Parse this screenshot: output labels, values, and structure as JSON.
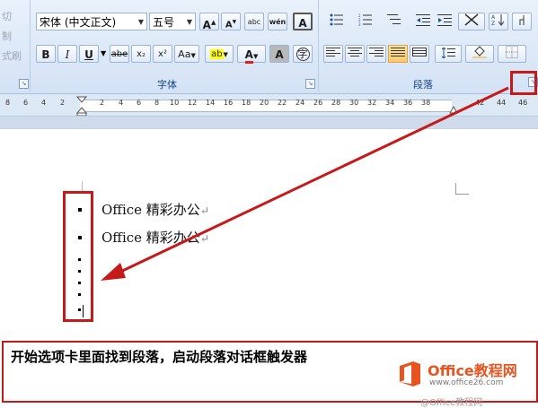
{
  "clipboard": {
    "items": [
      "切",
      "制",
      "式刷"
    ]
  },
  "font_group": {
    "label": "字体",
    "font_name": "宋体 (中文正文)",
    "font_size": "五号",
    "grow_label": "A",
    "shrink_label": "A",
    "phonetic_label": "abc",
    "wen_label": "wén",
    "border_label": "A",
    "bold_label": "B",
    "italic_label": "I",
    "underline_label": "U",
    "strike_label": "abe",
    "subscript_label": "x₂",
    "superscript_label": "x²",
    "case_label": "Aa",
    "highlight_label": "ab",
    "font_color_label": "A",
    "shading_label": "A",
    "enclose_label": "字",
    "highlight_color": "#ffff00",
    "font_color": "#e02020"
  },
  "paragraph_group": {
    "label": "段落"
  },
  "ruler": {
    "ticks": [
      "8",
      "6",
      "4",
      "2",
      "2",
      "4",
      "6",
      "8",
      "10",
      "12",
      "14",
      "16",
      "18",
      "20",
      "22",
      "24",
      "26",
      "28",
      "30",
      "32",
      "34",
      "36",
      "38",
      "42",
      "44",
      "46"
    ]
  },
  "document": {
    "lines": [
      "Office 精彩办公",
      "Office 精彩办公"
    ],
    "paragraph_mark": "↵"
  },
  "caption": {
    "text": "开始选项卡里面找到段落，启动段落对话框触发器"
  },
  "watermark": {
    "brand": "Office教程网",
    "url": "www.office26.com",
    "overlay": "@Office教程网"
  },
  "colors": {
    "annotation_red": "#c61a1a",
    "ribbon_blue": "#dbe7f7",
    "logo_orange": "#e8541f"
  }
}
